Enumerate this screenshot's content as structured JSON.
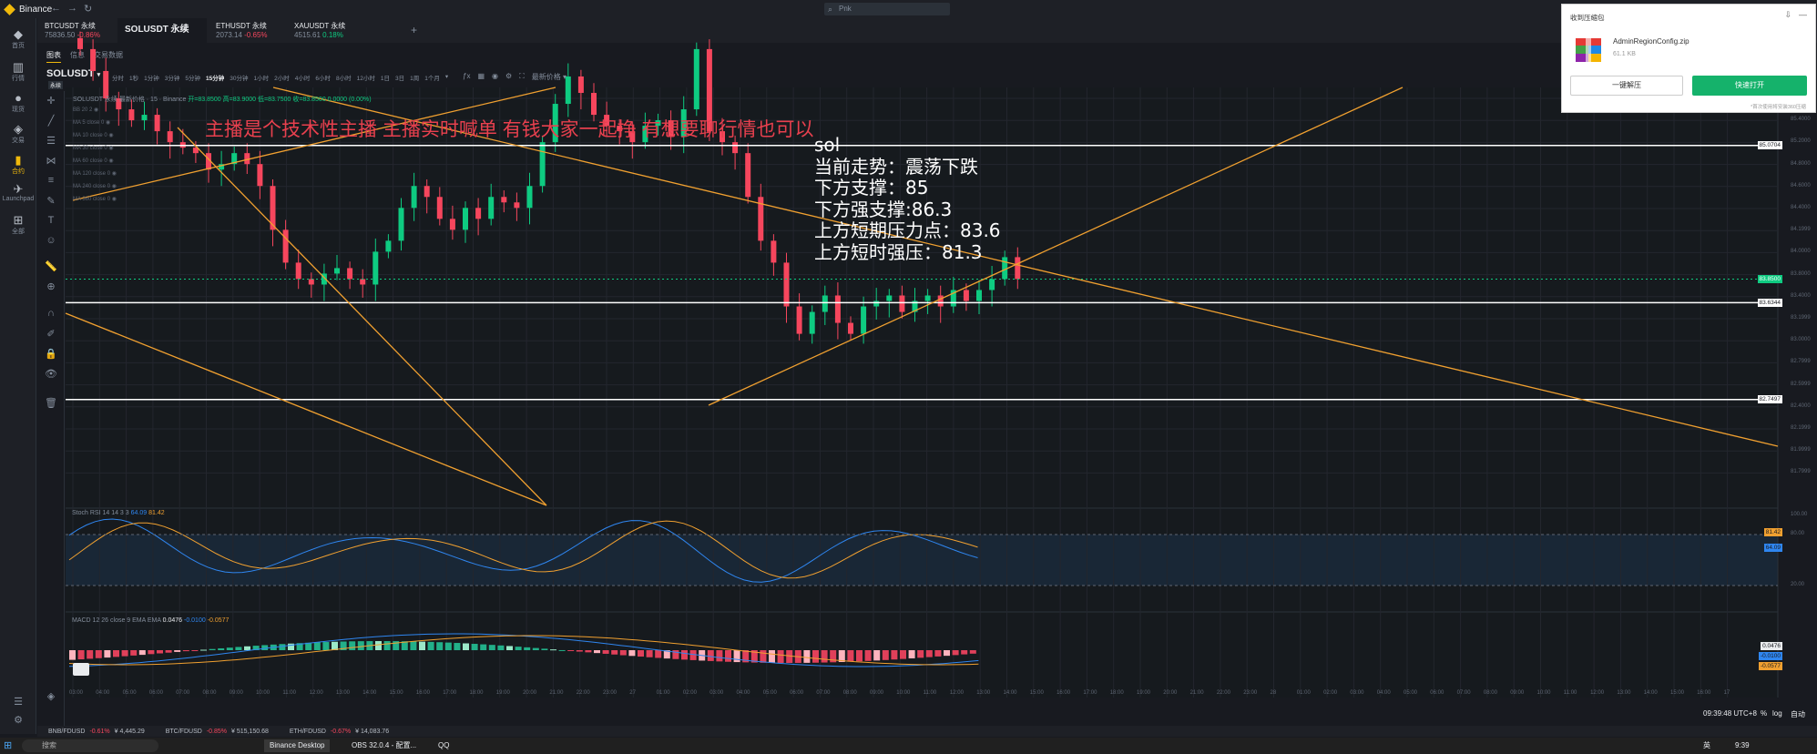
{
  "window": {
    "title": "Binance",
    "search_placeholder": "Pnk"
  },
  "appbar": [
    {
      "icon": "dashboard-icon",
      "glyph": "◆",
      "label": "首页"
    },
    {
      "icon": "chart-icon",
      "glyph": "▥",
      "label": "行情"
    },
    {
      "icon": "trade-icon",
      "glyph": "●",
      "label": "现货"
    },
    {
      "icon": "exchange-icon",
      "glyph": "◈",
      "label": "交易"
    },
    {
      "icon": "wallet-icon",
      "glyph": "▮",
      "label": "合约"
    },
    {
      "icon": "rocket-icon",
      "glyph": "✈",
      "label": "Launchpad"
    },
    {
      "icon": "grid-icon",
      "glyph": "⊞",
      "label": "全部"
    }
  ],
  "tabs": [
    {
      "name": "BTCUSDT 永续",
      "price": "75836.50",
      "change": "-0.86%",
      "dir": "dn"
    },
    {
      "name": "SOLUSDT 永续",
      "price": "",
      "change": "",
      "dir": "dn"
    },
    {
      "name": "ETHUSDT 永续",
      "price": "2073.14",
      "change": "-0.65%",
      "dir": "dn"
    },
    {
      "name": "XAUUSDT 永续",
      "price": "4515.61",
      "change": "0.18%",
      "dir": "up"
    }
  ],
  "subtabs": [
    "图表",
    "信息",
    "交易数据"
  ],
  "pair": {
    "name": "SOLUSDT",
    "sub": "永续"
  },
  "intervals": [
    "分时",
    "1秒",
    "1分钟",
    "3分钟",
    "5分钟",
    "15分钟",
    "30分钟",
    "1小时",
    "2小时",
    "4小时",
    "6小时",
    "8小时",
    "12小时",
    "1日",
    "3日",
    "1周",
    "1个月"
  ],
  "active_interval": "15分钟",
  "latest_price_label": "最新价格",
  "legend": {
    "title": "SOLUSDT 永续 最新价格 · 15 · Binance",
    "ohlc": "开=83.8500 高=83.9000 低=83.7500 收=83.8500 0.0000 (0.00%)"
  },
  "indicators": [
    "BB 20 2",
    "MA 5 close 0",
    "MA 10 close 0",
    "MA 30 close 0",
    "MA 60 close 0",
    "MA 120 close 0",
    "MA 240 close 0",
    "MA 360 close 0"
  ],
  "annotations": {
    "red_line": "主播是个技术性主播 主播实时喊单 有钱大家一起挣 有想要聊行情也可以",
    "box": [
      "sol",
      "当前走势：震荡下跌",
      "下方支撑：85",
      "下方强支撑:86.3",
      "上方短期压力点：83.6",
      "上方短时强压：81.3"
    ]
  },
  "stoch_rsi": {
    "label": "Stoch RSI 14 14 3 3",
    "k": "64.09",
    "d": "81.42",
    "axis": [
      "100.00",
      "80.00",
      "20.00"
    ]
  },
  "macd": {
    "label": "MACD 12 26 close 9 EMA EMA",
    "v1": "0.0476",
    "v2": "-0.0100",
    "v3": "-0.0577"
  },
  "price_axis": [
    "85.5999",
    "85.4000",
    "85.2000",
    "84.8000",
    "84.6000",
    "84.4000",
    "84.1999",
    "84.0000",
    "83.8000",
    "83.4000",
    "83.1999",
    "83.0000",
    "82.7999",
    "82.5999",
    "82.4000",
    "82.1999",
    "81.9999",
    "81.7999"
  ],
  "price_tags": [
    {
      "text": "85.0704",
      "color": "#ffffff",
      "bg": "#ffffff",
      "fg": "#181a20"
    },
    {
      "text": "83.8500",
      "color": "#0ecb81",
      "bg": "#0ecb81",
      "fg": "#ffffff"
    },
    {
      "text": "83.6344",
      "color": "#ffffff",
      "bg": "#ffffff",
      "fg": "#181a20"
    },
    {
      "text": "82.7497",
      "color": "#ffffff",
      "bg": "#ffffff",
      "fg": "#181a20"
    }
  ],
  "time_axis": [
    "03:00",
    "04:00",
    "05:00",
    "06:00",
    "07:00",
    "08:00",
    "09:00",
    "10:00",
    "11:00",
    "12:00",
    "13:00",
    "14:00",
    "15:00",
    "16:00",
    "17:00",
    "18:00",
    "19:00",
    "20:00",
    "21:00",
    "22:00",
    "23:00",
    "27",
    "01:00",
    "02:00",
    "03:00",
    "04:00",
    "05:00",
    "06:00",
    "07:00",
    "08:00",
    "09:00",
    "10:00",
    "11:00",
    "12:00",
    "13:00",
    "14:00",
    "15:00",
    "16:00",
    "17:00",
    "18:00",
    "19:00",
    "20:00",
    "21:00",
    "22:00",
    "23:00",
    "28",
    "01:00",
    "02:00",
    "03:00",
    "04:00",
    "05:00",
    "06:00",
    "07:00",
    "08:00",
    "09:00",
    "10:00",
    "11:00",
    "12:00",
    "13:00",
    "14:00",
    "15:00",
    "16:00",
    "17"
  ],
  "status": {
    "time": "09:39:48 UTC+8",
    "pct": "%",
    "log": "log",
    "auto": "自动"
  },
  "ticker": [
    {
      "sym": "BNB/FDUSD",
      "chg": "-0.61%",
      "price": "¥ 4,445.29"
    },
    {
      "sym": "BTC/FDUSD",
      "chg": "-0.85%",
      "price": "¥ 515,150.68"
    },
    {
      "sym": "ETH/FDUSD",
      "chg": "-0.67%",
      "price": "¥ 14,083.76"
    }
  ],
  "taskbar": {
    "search": "搜索",
    "apps": [
      "Binance Desktop",
      "OBS 32.0.4 - 配置...",
      "QQ"
    ],
    "clock": "9:39",
    "lang": "英"
  },
  "download": {
    "title": "收到压缩包",
    "file": "AdminRegionConfig.zip",
    "size": "61.1 KB",
    "btn_extract": "一键解压",
    "btn_open": "快速打开",
    "foot": "*首次使用将安装360压缩"
  },
  "colors": {
    "up": "#0ecb81",
    "down": "#f6465d",
    "accent": "#f0b90b",
    "trendline": "#f0a030"
  },
  "chart_data": {
    "type": "candlestick",
    "interval": "15分钟",
    "close_series": [
      85.95,
      85.75,
      85.5,
      85.4,
      85.3,
      85.35,
      85.2,
      85.1,
      85.05,
      85.0,
      84.85,
      84.9,
      85.0,
      84.9,
      84.7,
      84.3,
      84.0,
      83.85,
      83.8,
      83.9,
      83.95,
      83.85,
      83.8,
      84.1,
      84.2,
      84.5,
      84.7,
      84.6,
      84.4,
      84.3,
      84.5,
      84.4,
      84.6,
      84.55,
      84.5,
      84.7,
      85.1,
      85.45,
      85.7,
      85.55,
      85.35,
      85.25,
      85.2,
      85.1,
      85.25,
      85.3,
      85.15,
      85.4,
      85.95,
      85.2,
      85.1,
      85.0,
      84.6,
      84.2,
      84.0,
      83.6,
      83.35,
      83.55,
      83.7,
      83.45,
      83.35,
      83.6,
      83.65,
      83.7,
      83.55,
      83.65,
      83.7,
      83.6,
      83.75,
      83.65,
      83.75,
      83.85,
      84.05,
      83.85
    ],
    "support_lines": [
      85.0704,
      83.6344,
      82.7497
    ],
    "last_price": 83.85,
    "ylim": [
      81.7999,
      85.6
    ]
  }
}
